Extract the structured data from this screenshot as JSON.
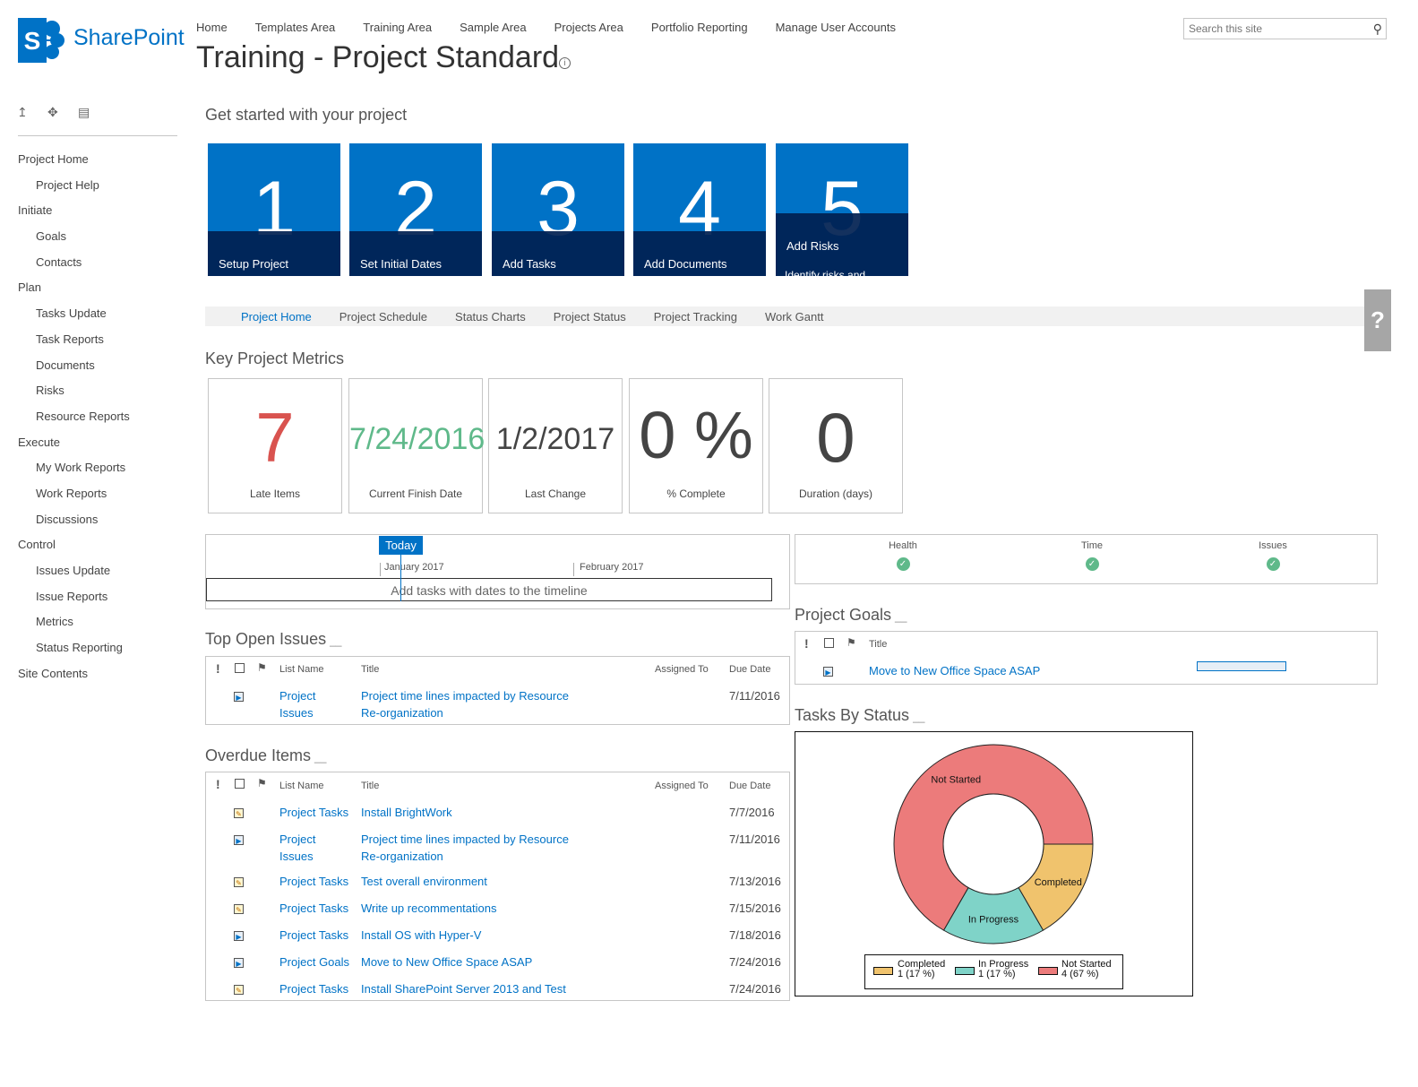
{
  "brand": {
    "name": "SharePoint",
    "color": "#0072c6"
  },
  "top_nav": [
    "Home",
    "Templates Area",
    "Training Area",
    "Sample Area",
    "Projects Area",
    "Portfolio Reporting",
    "Manage User Accounts"
  ],
  "page_title": "Training - Project Standard",
  "search": {
    "placeholder": "Search this site",
    "icon": "search-icon"
  },
  "quick_launch_tools": [
    "edit-links-icon",
    "move-icon",
    "list-icon"
  ],
  "quick_launch": [
    {
      "label": "Project Home",
      "level": 0
    },
    {
      "label": "Project Help",
      "level": 1
    },
    {
      "label": "Initiate",
      "level": 0
    },
    {
      "label": "Goals",
      "level": 1
    },
    {
      "label": "Contacts",
      "level": 1
    },
    {
      "label": "Plan",
      "level": 0
    },
    {
      "label": "Tasks Update",
      "level": 1
    },
    {
      "label": "Task Reports",
      "level": 1
    },
    {
      "label": "Documents",
      "level": 1
    },
    {
      "label": "Risks",
      "level": 1
    },
    {
      "label": "Resource Reports",
      "level": 1
    },
    {
      "label": "Execute",
      "level": 0
    },
    {
      "label": "My Work Reports",
      "level": 1
    },
    {
      "label": "Work Reports",
      "level": 1
    },
    {
      "label": "Discussions",
      "level": 1
    },
    {
      "label": "Control",
      "level": 0
    },
    {
      "label": "Issues Update",
      "level": 1
    },
    {
      "label": "Issue Reports",
      "level": 1
    },
    {
      "label": "Metrics",
      "level": 1
    },
    {
      "label": "Status Reporting",
      "level": 1
    },
    {
      "label": "Site Contents",
      "level": 0
    }
  ],
  "get_started": {
    "title": "Get started with your project",
    "tiles": [
      {
        "num": "1",
        "label": "Setup Project"
      },
      {
        "num": "2",
        "label": "Set Initial Dates"
      },
      {
        "num": "3",
        "label": "Add Tasks"
      },
      {
        "num": "4",
        "label": "Add Documents"
      },
      {
        "num": "5",
        "label": "Add Risks",
        "sublabel": "Identify risks and"
      }
    ]
  },
  "tabs": [
    "Project Home",
    "Project Schedule",
    "Status Charts",
    "Project Status",
    "Project Tracking",
    "Work Gantt"
  ],
  "help_tab": "?",
  "metrics": {
    "title": "Key Project Metrics",
    "items": [
      {
        "value": "7",
        "caption": "Late Items",
        "color": "#d9534f"
      },
      {
        "value": "7/24/2016",
        "caption": "Current Finish Date",
        "color": "#5fb98a"
      },
      {
        "value": "1/2/2017",
        "caption": "Last Change",
        "color": "#444444"
      },
      {
        "value": "0 %",
        "caption": "% Complete",
        "color": "#444444"
      },
      {
        "value": "0",
        "caption": "Duration (days)",
        "color": "#444444"
      }
    ]
  },
  "timeline": {
    "today_label": "Today",
    "months": [
      "January 2017",
      "February 2017"
    ],
    "empty_text": "Add tasks with dates to the timeline"
  },
  "status_indicators": [
    {
      "label": "Health",
      "state": "ok"
    },
    {
      "label": "Time",
      "state": "ok"
    },
    {
      "label": "Issues",
      "state": "ok"
    }
  ],
  "list_headers": {
    "list_name": "List Name",
    "title": "Title",
    "assigned_to": "Assigned To",
    "due_date": "Due Date"
  },
  "top_open_issues": {
    "title": "Top Open Issues",
    "rows": [
      {
        "icon": "issue",
        "list": "Project Issues",
        "list_l1": "Project",
        "list_l2": "Issues",
        "title_l1": "Project time lines impacted by Resource",
        "title_l2": "Re-organization",
        "due": "7/11/2016"
      }
    ]
  },
  "overdue_items": {
    "title": "Overdue Items",
    "rows": [
      {
        "icon": "task",
        "list": "Project Tasks",
        "title": "Install BrightWork",
        "due": "7/7/2016"
      },
      {
        "icon": "issue",
        "list_l1": "Project",
        "list_l2": "Issues",
        "title_l1": "Project time lines impacted by Resource",
        "title_l2": "Re-organization",
        "due": "7/11/2016"
      },
      {
        "icon": "task",
        "list": "Project Tasks",
        "title": "Test overall environment",
        "due": "7/13/2016"
      },
      {
        "icon": "task",
        "list": "Project Tasks",
        "title": "Write up recommentations",
        "due": "7/15/2016"
      },
      {
        "icon": "issue",
        "list": "Project Tasks",
        "title": "Install OS with Hyper-V",
        "due": "7/18/2016"
      },
      {
        "icon": "issue",
        "list": "Project Goals",
        "title": "Move to New Office Space ASAP",
        "due": "7/24/2016"
      },
      {
        "icon": "task",
        "list": "Project Tasks",
        "title": "Install SharePoint Server 2013 and Test",
        "due": "7/24/2016"
      }
    ]
  },
  "project_goals": {
    "title": "Project Goals",
    "header_title": "Title",
    "rows": [
      {
        "title": "Move to New Office Space ASAP",
        "progress": 0
      }
    ]
  },
  "tasks_by_status": {
    "title": "Tasks By Status"
  },
  "chart_data": {
    "type": "pie",
    "donut": true,
    "slices": [
      {
        "label": "Completed",
        "value": 1,
        "percent": "17 %",
        "color": "#f0c36d"
      },
      {
        "label": "In Progress",
        "value": 1,
        "percent": "17 %",
        "color": "#7fd3c8"
      },
      {
        "label": "Not Started",
        "value": 4,
        "percent": "67 %",
        "color": "#ec7b7b"
      }
    ],
    "legend": [
      {
        "label": "Completed",
        "detail": "1 (17 %)"
      },
      {
        "label": "In Progress",
        "detail": "1 (17 %)"
      },
      {
        "label": "Not Started",
        "detail": "4 (67 %)"
      }
    ],
    "legend_position": "bottom"
  }
}
